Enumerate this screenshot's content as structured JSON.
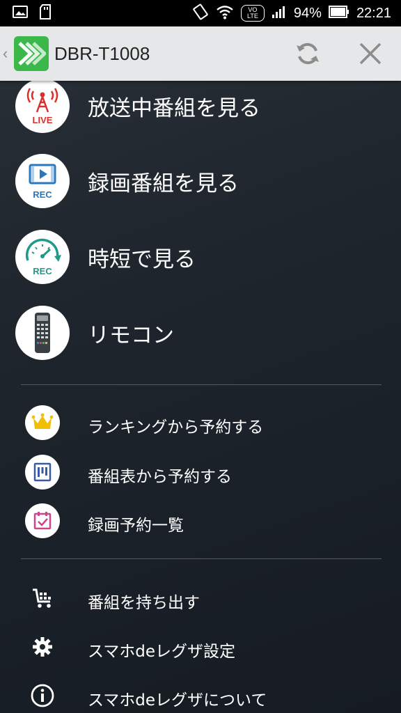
{
  "status_bar": {
    "battery": "94%",
    "time": "22:21",
    "network_badge": "VO LTE"
  },
  "app_bar": {
    "title": "DBR-T1008"
  },
  "main_menu": [
    {
      "label": "放送中番組を見る",
      "icon": "live-broadcast-icon",
      "icon_text": "LIVE"
    },
    {
      "label": "録画番組を見る",
      "icon": "recorded-program-icon",
      "icon_text": "REC"
    },
    {
      "label": "時短で見る",
      "icon": "time-saving-icon",
      "icon_text": "REC"
    },
    {
      "label": "リモコン",
      "icon": "remote-control-icon"
    }
  ],
  "reservation_menu": [
    {
      "label": "ランキングから予約する",
      "icon": "crown-icon"
    },
    {
      "label": "番組表から予約する",
      "icon": "program-guide-icon"
    },
    {
      "label": "録画予約一覧",
      "icon": "calendar-check-icon"
    }
  ],
  "utility_menu": [
    {
      "label": "番組を持ち出す",
      "icon": "cart-icon"
    },
    {
      "label": "スマホdeレグザ設定",
      "icon": "gear-icon"
    },
    {
      "label": "スマホdeレグザについて",
      "icon": "info-icon"
    }
  ],
  "colors": {
    "app_logo": "#3cb84a",
    "live_red": "#d9302c",
    "rec_blue": "#2878c0",
    "rec_teal": "#1f9a8a",
    "crown_yellow": "#f0c000",
    "guide_blue": "#3a58a8",
    "calendar_pink": "#d0448a"
  }
}
